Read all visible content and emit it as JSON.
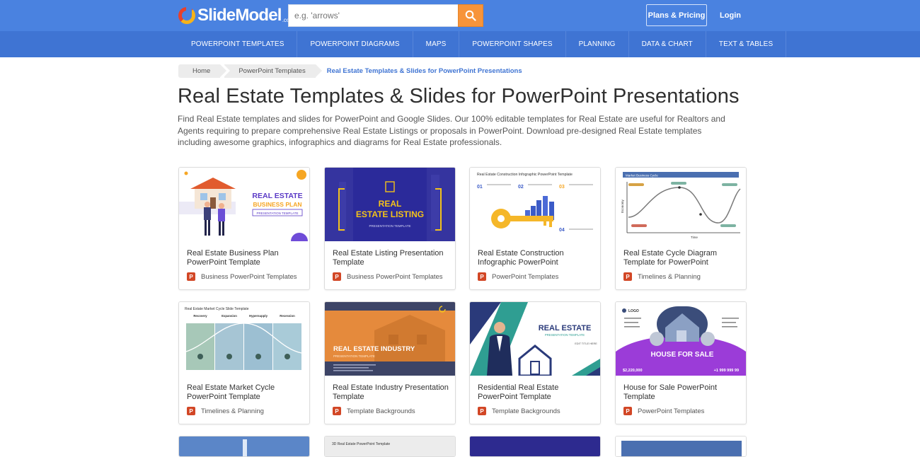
{
  "header": {
    "logo_text": "SlideModel",
    "logo_suffix": ".com",
    "search_placeholder": "e.g. 'arrows'",
    "plans_label": "Plans & Pricing",
    "login_label": "Login"
  },
  "nav": [
    "POWERPOINT TEMPLATES",
    "POWERPOINT DIAGRAMS",
    "MAPS",
    "POWERPOINT SHAPES",
    "PLANNING",
    "DATA & CHART",
    "TEXT & TABLES"
  ],
  "breadcrumb": {
    "home": "Home",
    "section": "PowerPoint Templates",
    "current": "Real Estate Templates & Slides for PowerPoint Presentations"
  },
  "page": {
    "title": "Real Estate Templates & Slides for PowerPoint Presentations",
    "description": "Find Real Estate templates and slides for PowerPoint and Google Slides. Our 100% editable templates for Real Estate are useful for Realtors and Agents requiring to prepare comprehensive Real Estate Listings or proposals in PowerPoint. Download pre-designed Real Estate templates including awesome graphics, infographics and diagrams for Real Estate professionals."
  },
  "thumb_text": {
    "c1_line1": "REAL ESTATE",
    "c1_line2": "BUSINESS PLAN",
    "c1_line3": "PRESENTATION TEMPLATE",
    "c2_line1": "REAL",
    "c2_line2": "ESTATE LISTING",
    "c2_line3": "PRESENTATION TEMPLATE",
    "c3_title": "Real Estate Construction Infographic PowerPoint Template",
    "c3_n1": "01",
    "c3_n2": "02",
    "c3_n3": "03",
    "c3_n4": "04",
    "c4_title": "Market Business Cycle",
    "c4_xlabel": "Time",
    "c4_ylabel": "Economy",
    "c5_title": "Real Estate Market Cycle Slide Template",
    "c5_col1": "Recovery",
    "c5_col2": "Expansion",
    "c5_col3": "Hypersupply",
    "c5_col4": "Recession",
    "c6_line1": "REAL ESTATE INDUSTRY",
    "c6_line2": "PRESENTATION TEMPLATE",
    "c7_line1": "REAL ESTATE",
    "c7_line2": "PRESENTATION TEMPLATE",
    "c7_line3": "EDIT TITLE HERE",
    "c8_logo": "LOGO",
    "c8_banner": "HOUSE FOR SALE",
    "c8_price": "$2,220,000",
    "c8_phone": "+1 999 999 99",
    "p2_title": "3D Real Estate PowerPoint Template"
  },
  "cards": [
    {
      "title": "Real Estate Business Plan PowerPoint Template",
      "category": "Business PowerPoint Templates"
    },
    {
      "title": "Real Estate Listing Presentation Template",
      "category": "Business PowerPoint Templates"
    },
    {
      "title": "Real Estate Construction Infographic PowerPoint",
      "category": "PowerPoint Templates"
    },
    {
      "title": "Real Estate Cycle Diagram Template for PowerPoint",
      "category": "Timelines & Planning"
    },
    {
      "title": "Real Estate Market Cycle PowerPoint Template",
      "category": "Timelines & Planning"
    },
    {
      "title": "Real Estate Industry Presentation Template",
      "category": "Template Backgrounds"
    },
    {
      "title": "Residential Real Estate PowerPoint Template",
      "category": "Template Backgrounds"
    },
    {
      "title": "House for Sale PowerPoint Template",
      "category": "PowerPoint Templates"
    }
  ],
  "icons": {
    "ppt_glyph": "P"
  },
  "colors": {
    "header_bg": "#4a82e0",
    "nav_bg": "#3f74d3",
    "search_button": "#f7943a",
    "ppt_icon": "#d24726"
  }
}
